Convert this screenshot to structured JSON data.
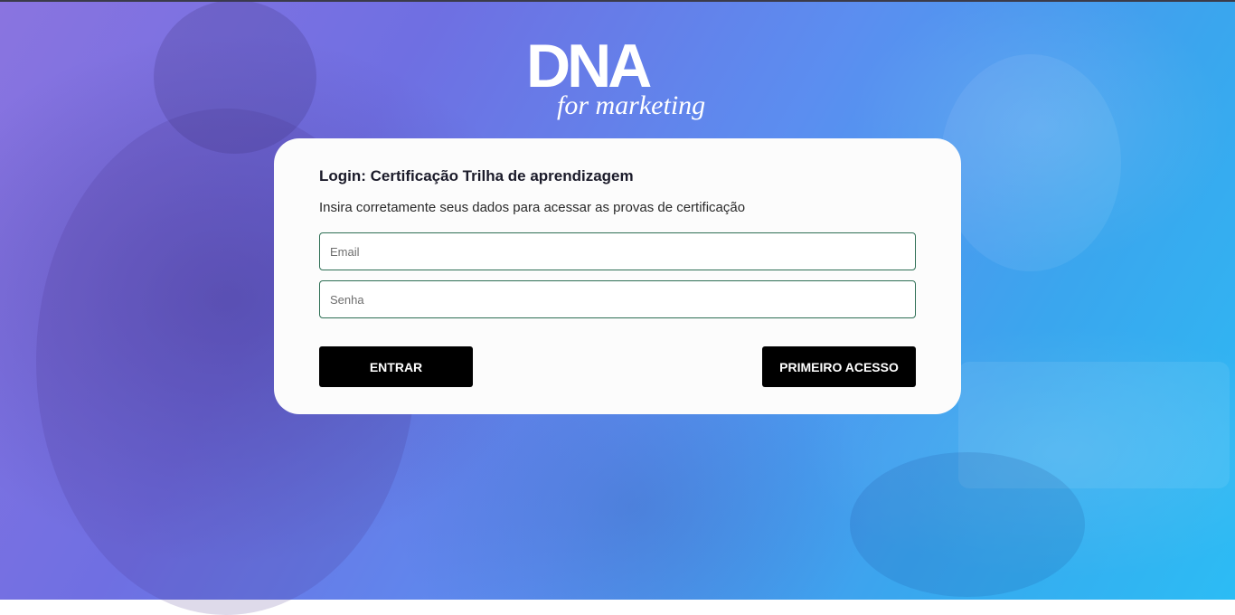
{
  "brand": {
    "logo_main": "DNA",
    "logo_sub": "for marketing"
  },
  "login": {
    "title": "Login: Certificação Trilha de aprendizagem",
    "subtitle": "Insira corretamente seus dados para acessar as provas de certificação",
    "email_placeholder": "Email",
    "email_value": "",
    "password_placeholder": "Senha",
    "password_value": "",
    "enter_label": "ENTRAR",
    "first_access_label": "PRIMEIRO ACESSO"
  },
  "colors": {
    "background_start": "#8a74e0",
    "background_end": "#2cbcf4",
    "card": "#fcfcfc",
    "field_border": "#2e6f55",
    "button": "#000000",
    "button_text": "#ffffff"
  }
}
